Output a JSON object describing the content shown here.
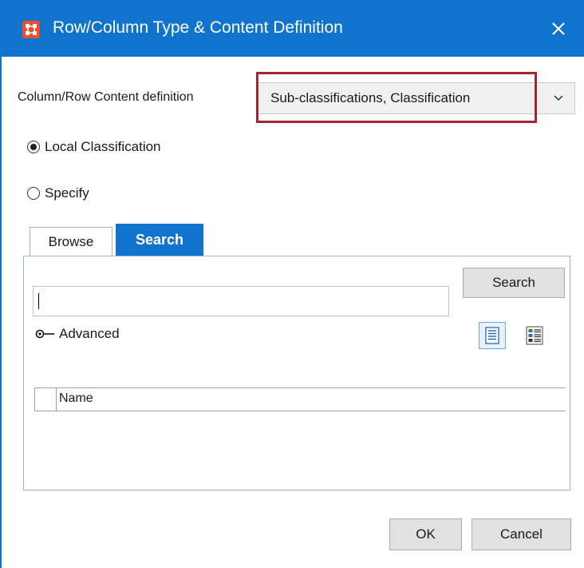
{
  "window": {
    "title": "Row/Column Type & Content Definition",
    "titlebar_color": "#1074cf",
    "close_icon": "close-icon"
  },
  "content_definition": {
    "label": "Column/Row Content definition",
    "selected_value": "Sub-classifications, Classification",
    "highlight_color": "#a1262e"
  },
  "radios": [
    {
      "label": "Local Classification",
      "checked": true
    },
    {
      "label": "Specify",
      "checked": false
    }
  ],
  "tabs": [
    {
      "label": "Browse",
      "active": false
    },
    {
      "label": "Search",
      "active": true
    }
  ],
  "search": {
    "input_value": "",
    "button_label": "Search",
    "advanced_label": "Advanced"
  },
  "table": {
    "columns": [
      "Name"
    ]
  },
  "footer": {
    "ok_label": "OK",
    "cancel_label": "Cancel"
  }
}
